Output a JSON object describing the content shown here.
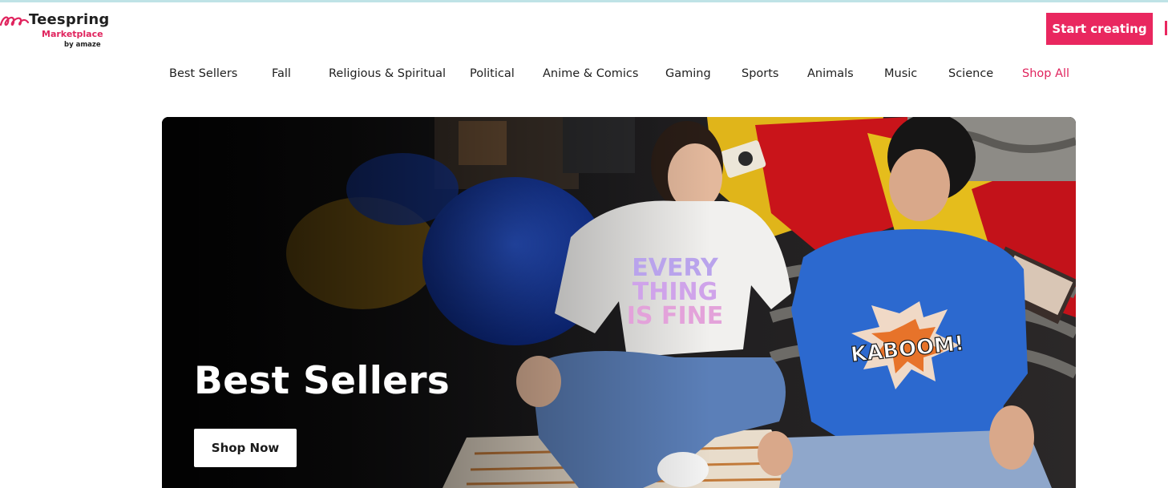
{
  "brand": {
    "name": "Teespring",
    "subtitle": "Marketplace",
    "byline": "by amaze"
  },
  "header": {
    "cta_label": "Start creating"
  },
  "nav": {
    "categories": [
      "Best Sellers",
      "Fall",
      "Religious & Spiritual",
      "Political",
      "Anime & Comics",
      "Gaming",
      "Sports",
      "Animals",
      "Music",
      "Science",
      "Shop All"
    ]
  },
  "hero": {
    "title": "Best Sellers",
    "button_label": "Shop Now",
    "shirt_left_text": [
      "EVERY",
      "THING",
      "IS FINE"
    ],
    "shirt_right_text": "KABOOM!"
  },
  "colors": {
    "accent": "#e9275f",
    "brand_pink": "#e0245e",
    "text": "#1f1f1f"
  }
}
